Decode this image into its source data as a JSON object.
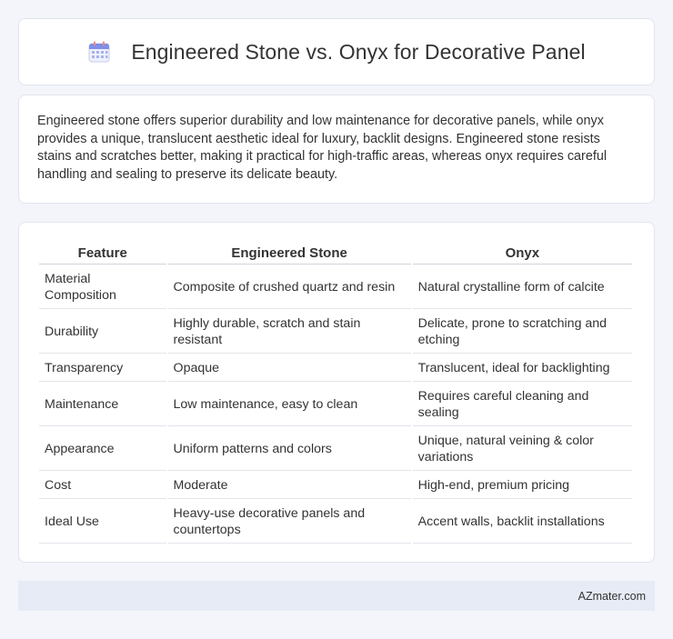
{
  "header": {
    "title": "Engineered Stone vs. Onyx for Decorative Panel",
    "icon": "calendar-icon"
  },
  "summary": {
    "text": "Engineered stone offers superior durability and low maintenance for decorative panels, while onyx provides a unique, translucent aesthetic ideal for luxury, backlit designs. Engineered stone resists stains and scratches better, making it practical for high-traffic areas, whereas onyx requires careful handling and sealing to preserve its delicate beauty."
  },
  "table": {
    "headers": [
      "Feature",
      "Engineered Stone",
      "Onyx"
    ],
    "rows": [
      [
        "Material Composition",
        "Composite of crushed quartz and resin",
        "Natural crystalline form of calcite"
      ],
      [
        "Durability",
        "Highly durable, scratch and stain resistant",
        "Delicate, prone to scratching and etching"
      ],
      [
        "Transparency",
        "Opaque",
        "Translucent, ideal for backlighting"
      ],
      [
        "Maintenance",
        "Low maintenance, easy to clean",
        "Requires careful cleaning and sealing"
      ],
      [
        "Appearance",
        "Uniform patterns and colors",
        "Unique, natural veining & color variations"
      ],
      [
        "Cost",
        "Moderate",
        "High-end, premium pricing"
      ],
      [
        "Ideal Use",
        "Heavy-use decorative panels and countertops",
        "Accent walls, backlit installations"
      ]
    ]
  },
  "footer": {
    "text": "AZmater.com"
  }
}
